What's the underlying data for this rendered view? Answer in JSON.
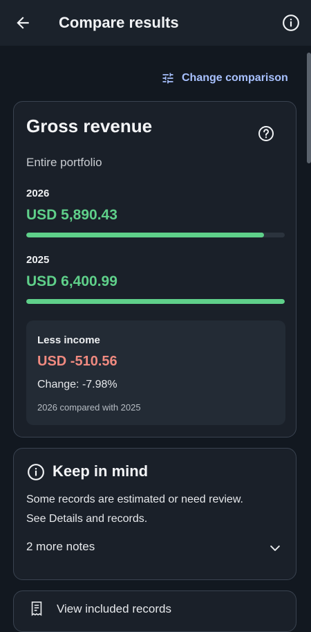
{
  "appbar": {
    "title": "Compare results"
  },
  "actions": {
    "change_comparison": "Change comparison"
  },
  "revenue_card": {
    "title": "Gross revenue",
    "scope": "Entire portfolio",
    "current": {
      "year": "2026",
      "amount": "USD 5,890.43",
      "bar_fraction": 0.92
    },
    "previous": {
      "year": "2025",
      "amount": "USD 6,400.99",
      "bar_fraction": 1.0
    },
    "summary": {
      "label": "Less income",
      "difference": "USD -510.56",
      "change": "Change: -7.98%",
      "note": "2026 compared with 2025"
    }
  },
  "notes_card": {
    "title": "Keep in mind",
    "text": "Some records are estimated or need review. See Details and records.",
    "more": "2 more notes"
  },
  "records_card": {
    "label": "View included records"
  },
  "colors": {
    "positive": "#5fd08a",
    "negative": "#f08a80",
    "accent": "#a8c1ff"
  }
}
